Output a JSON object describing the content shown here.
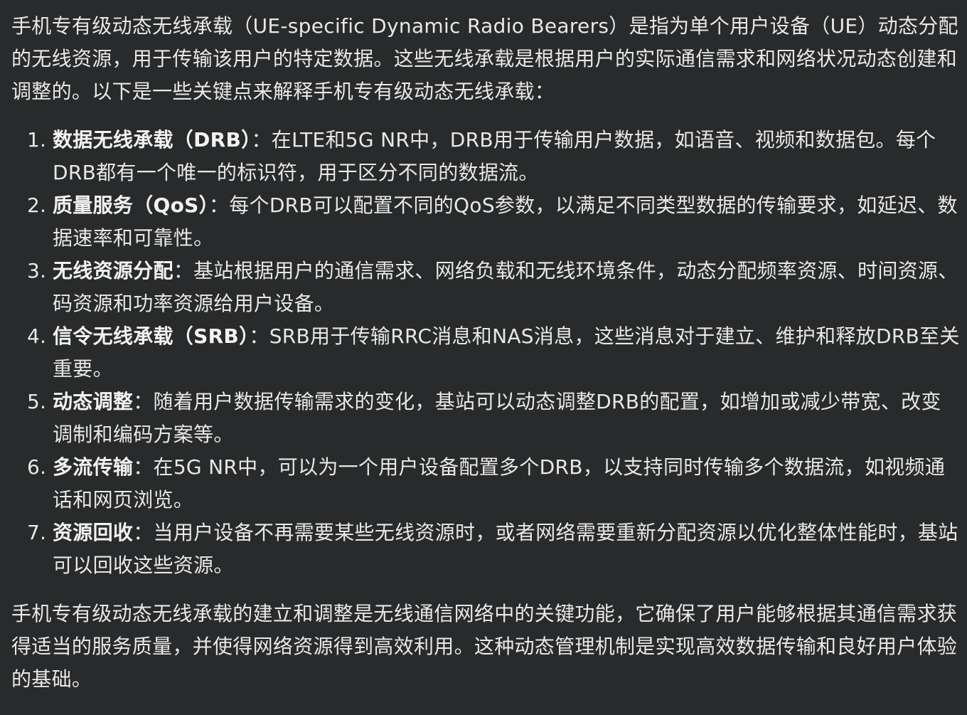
{
  "intro": "手机专有级动态无线承载（UE-specific Dynamic Radio Bearers）是指为单个用户设备（UE）动态分配的无线资源，用于传输该用户的特定数据。这些无线承载是根据用户的实际通信需求和网络状况动态创建和调整的。以下是一些关键点来解释手机专有级动态无线承载：",
  "points": [
    {
      "num": "1.",
      "term": "数据无线承载（DRB）",
      "sep": "：",
      "text": "在LTE和5G NR中，DRB用于传输用户数据，如语音、视频和数据包。每个DRB都有一个唯一的标识符，用于区分不同的数据流。"
    },
    {
      "num": "2.",
      "term": "质量服务（QoS）",
      "sep": "：",
      "text": "每个DRB可以配置不同的QoS参数，以满足不同类型数据的传输要求，如延迟、数据速率和可靠性。"
    },
    {
      "num": "3.",
      "term": "无线资源分配",
      "sep": "：",
      "text": "基站根据用户的通信需求、网络负载和无线环境条件，动态分配频率资源、时间资源、码资源和功率资源给用户设备。"
    },
    {
      "num": "4.",
      "term": "信令无线承载（SRB）",
      "sep": "：",
      "text": "SRB用于传输RRC消息和NAS消息，这些消息对于建立、维护和释放DRB至关重要。"
    },
    {
      "num": "5.",
      "term": "动态调整",
      "sep": "：",
      "text": "随着用户数据传输需求的变化，基站可以动态调整DRB的配置，如增加或减少带宽、改变调制和编码方案等。"
    },
    {
      "num": "6.",
      "term": "多流传输",
      "sep": "：",
      "text": "在5G NR中，可以为一个用户设备配置多个DRB，以支持同时传输多个数据流，如视频通话和网页浏览。"
    },
    {
      "num": "7.",
      "term": "资源回收",
      "sep": "：",
      "text": "当用户设备不再需要某些无线资源时，或者网络需要重新分配资源以优化整体性能时，基站可以回收这些资源。"
    }
  ],
  "conclusion": "手机专有级动态无线承载的建立和调整是无线通信网络中的关键功能，它确保了用户能够根据其通信需求获得适当的服务质量，并使得网络资源得到高效利用。这种动态管理机制是实现高效数据传输和良好用户体验的基础。"
}
